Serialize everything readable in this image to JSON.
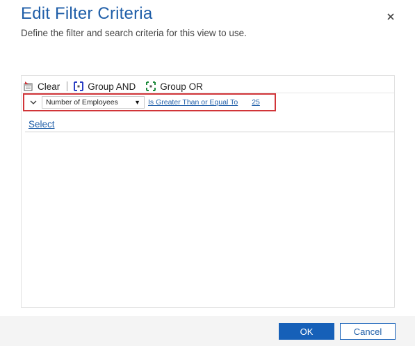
{
  "dialog": {
    "title": "Edit Filter Criteria",
    "subtitle": "Define the filter and search criteria for this view to use.",
    "close_icon": "close-icon"
  },
  "toolbar": {
    "clear_label": "Clear",
    "clear_icon": "clear-filter-icon",
    "group_and_label": "Group AND",
    "group_and_icon": "group-and-icon",
    "group_or_label": "Group OR",
    "group_or_icon": "group-or-icon"
  },
  "condition": {
    "expand_icon": "chevron-down-icon",
    "field": "Number of Employees",
    "operator": "Is Greater Than or Equal To",
    "value": "25",
    "highlight_color": "#d13438"
  },
  "select_label": "Select",
  "footer": {
    "ok_label": "OK",
    "cancel_label": "Cancel"
  },
  "colors": {
    "accent": "#1660b8",
    "title": "#1f5ea8",
    "footer_bg": "#f4f4f4"
  }
}
